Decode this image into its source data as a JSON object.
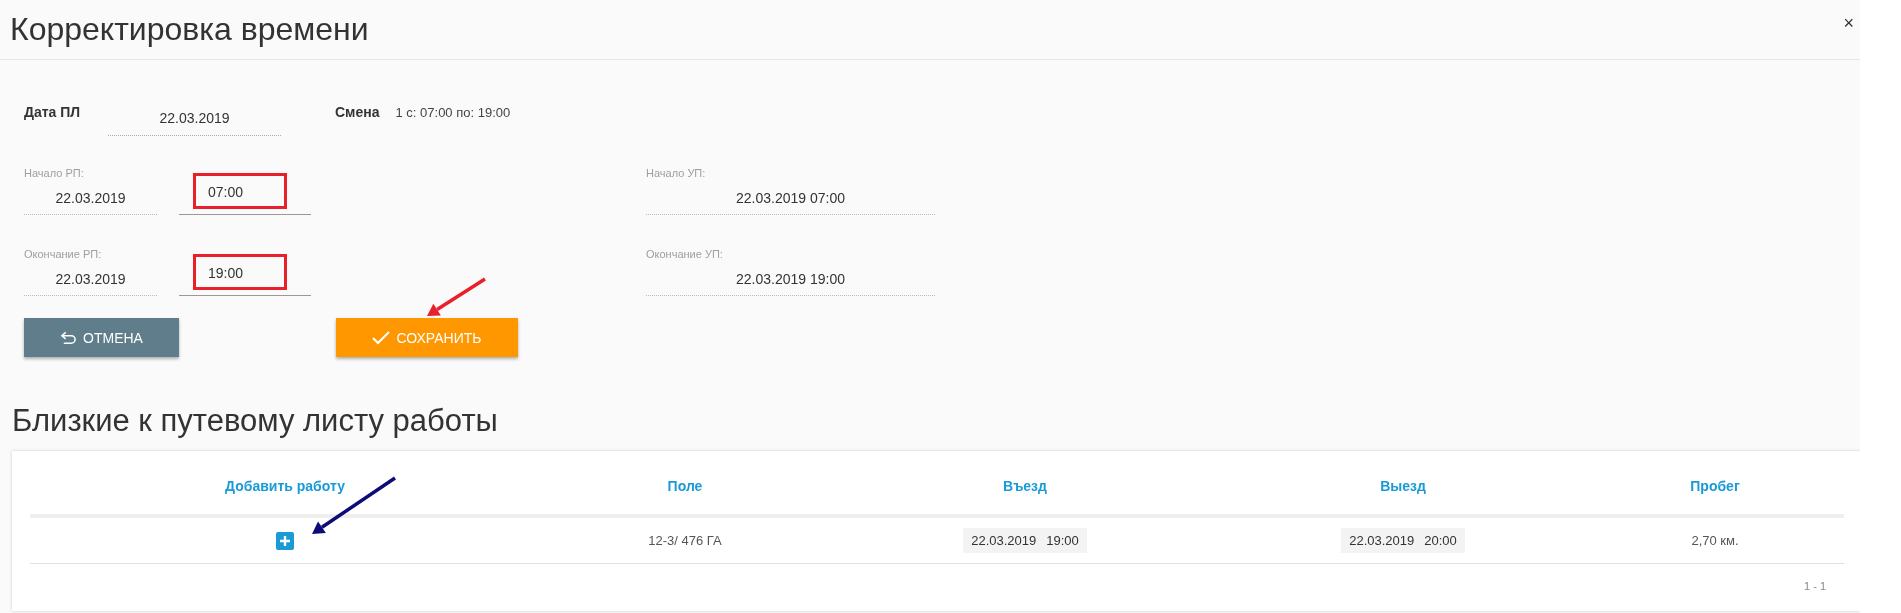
{
  "dialog": {
    "title": "Корректировка времени",
    "close": "×"
  },
  "form": {
    "date": {
      "label": "Дата ПЛ",
      "value": "22.03.2019"
    },
    "shift": {
      "label": "Смена",
      "value": "1 с: 07:00 по: 19:00"
    },
    "rows": [
      {
        "label": "Начало РП:",
        "date": "22.03.2019",
        "time": "07:00",
        "highlighted": true,
        "result_label": "Начало УП:",
        "result": "22.03.2019 07:00"
      },
      {
        "label": "Окончание РП:",
        "date": "22.03.2019",
        "time": "19:00",
        "highlighted": true,
        "result_label": "Окончание УП:",
        "result": "22.03.2019 19:00"
      }
    ]
  },
  "buttons": [
    {
      "kind": "cancel",
      "label": "ОТМЕНА"
    },
    {
      "kind": "save",
      "label": "СОХРАНИТЬ"
    }
  ],
  "section_title": "Близкие к путевому листу работы",
  "table": {
    "columns": [
      "Добавить работу",
      "Поле",
      "Въезд",
      "Выезд",
      "Пробег"
    ],
    "rows": [
      {
        "field": "12-3/ 476 ГА",
        "entry": {
          "date": "22.03.2019",
          "time": "19:00"
        },
        "exit": {
          "date": "22.03.2019",
          "time": "20:00"
        },
        "mileage": "2,70 км."
      }
    ],
    "pager": "1 - 1"
  },
  "annotations": [
    {
      "kind": "arrow",
      "color": "#e8202a"
    },
    {
      "kind": "arrow",
      "color": "#0c0c78"
    }
  ]
}
